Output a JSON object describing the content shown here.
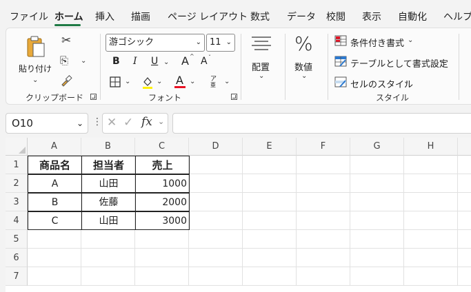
{
  "menu": {
    "tabs": [
      "ファイル",
      "ホーム",
      "挿入",
      "描画",
      "ページ レイアウト",
      "数式",
      "データ",
      "校閲",
      "表示",
      "自動化",
      "ヘルプ"
    ]
  },
  "ribbon": {
    "clipboard": {
      "paste_label": "貼り付け",
      "group_label": "クリップボード"
    },
    "font": {
      "font_name": "游ゴシック",
      "font_size": "11",
      "bold": "B",
      "italic": "I",
      "underline": "U",
      "grow": "A",
      "shrink": "A",
      "font_color": "A",
      "phonetic": "ア",
      "group_label": "フォント"
    },
    "alignment": {
      "label": "配置"
    },
    "number": {
      "symbol": "%",
      "label": "数値"
    },
    "styles": {
      "conditional": "条件付き書式",
      "table": "テーブルとして書式設定",
      "cell_styles": "セルのスタイル",
      "group_label": "スタイル"
    }
  },
  "formula_bar": {
    "name_box": "O10",
    "fx": "fx",
    "formula": ""
  },
  "sheet": {
    "columns": [
      "A",
      "B",
      "C",
      "D",
      "E",
      "F",
      "G",
      "H"
    ],
    "rows": [
      "1",
      "2",
      "3",
      "4",
      "5",
      "6",
      "7"
    ],
    "table": {
      "headers": [
        "商品名",
        "担当者",
        "売上"
      ],
      "data": [
        [
          "A",
          "山田",
          "1000"
        ],
        [
          "B",
          "佐藤",
          "2000"
        ],
        [
          "C",
          "山田",
          "3000"
        ]
      ]
    }
  },
  "colors": {
    "accent": "#1f7a45",
    "font_color_bar": "#e81123"
  }
}
